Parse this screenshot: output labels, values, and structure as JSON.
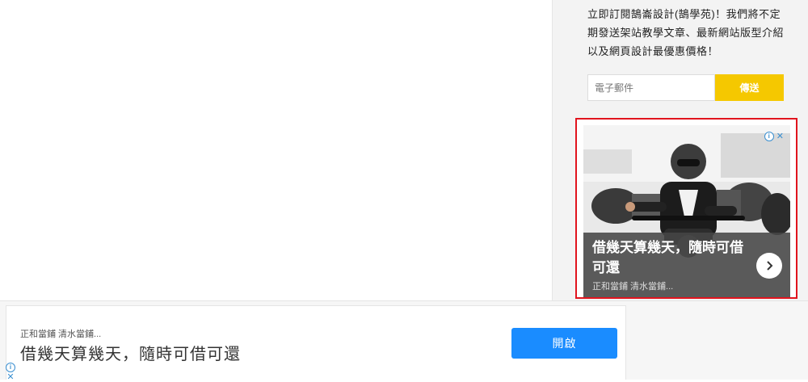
{
  "sidebar": {
    "promo_text": "立即訂閱鵠崙設計(鵠學苑)！我們將不定期發送架站教學文章、最新網站版型介紹以及網頁設計最優惠價格！",
    "email_placeholder": "電子郵件",
    "send_label": "傳送"
  },
  "sidebar_ad": {
    "headline": "借幾天算幾天，隨時可借可還",
    "advertiser": "正和當鋪 清水當鋪...",
    "info_icon": "info-icon",
    "close_icon": "close-icon",
    "next_icon": "chevron-right-icon",
    "border_color": "#e1141e"
  },
  "anchor_ad": {
    "advertiser": "正和當鋪 清水當鋪...",
    "headline": "借幾天算幾天，隨時可借可還",
    "open_label": "開啟",
    "button_color": "#1a8cff"
  },
  "colors": {
    "send_button": "#f5c800",
    "sidebar_bg": "#f3f3f3"
  }
}
